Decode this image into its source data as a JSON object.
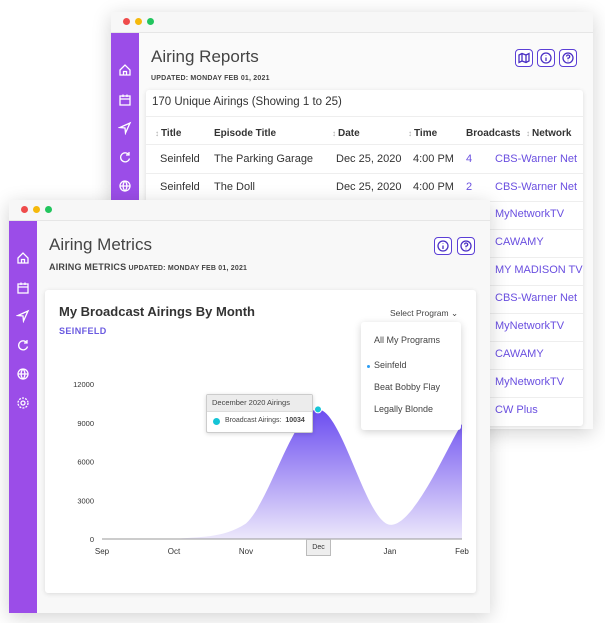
{
  "reports": {
    "title": "Airing Reports",
    "updated": "UPDATED: MONDAY FEB 01, 2021",
    "caption": "170 Unique Airings (Showing 1 to 25)",
    "columns": [
      "Title",
      "Episode Title",
      "Date",
      "Time",
      "Broadcasts",
      "Network"
    ],
    "rows": [
      {
        "title": "Seinfeld",
        "episode": "The Parking Garage",
        "date": "Dec 25, 2020",
        "time": "4:00 PM",
        "broadcasts": "4",
        "network": "CBS-Warner Net"
      },
      {
        "title": "Seinfeld",
        "episode": "The Doll",
        "date": "Dec 25, 2020",
        "time": "4:00 PM",
        "broadcasts": "2",
        "network": "CBS-Warner Net"
      }
    ],
    "more_networks": [
      "MyNetworkTV",
      "CAWAMY",
      "MY MADISON TV",
      "CBS-Warner Net",
      "MyNetworkTV",
      "CAWAMY",
      "MyNetworkTV",
      "CW Plus"
    ]
  },
  "metrics": {
    "title": "Airing Metrics",
    "updated_label": "AIRING METRICS",
    "updated": "UPDATED: MONDAY FEB 01, 2021",
    "chart_title": "My Broadcast Airings By Month",
    "program": "SEINFELD",
    "select_label": "Select Program",
    "dropdown": [
      "All My Programs",
      "Seinfeld",
      "Beat Bobby Flay",
      "Legally Blonde"
    ],
    "tooltip_title": "December 2020 Airings",
    "tooltip_label": "Broadcast Airings:",
    "tooltip_value": "10034",
    "highlight_label": "Dec"
  },
  "chart_data": {
    "type": "area",
    "title": "My Broadcast Airings By Month",
    "subtitle": "SEINFELD",
    "categories": [
      "Sep",
      "Oct",
      "Nov",
      "Dec",
      "Jan",
      "Feb"
    ],
    "series": [
      {
        "name": "Broadcast Airings",
        "values": [
          0,
          0,
          1200,
          10034,
          1100,
          8900
        ]
      }
    ],
    "yticks": [
      0,
      3000,
      6000,
      9000,
      12000
    ],
    "ylim": [
      0,
      12000
    ],
    "colors": {
      "fill_top": "#6b4cf0",
      "fill_bottom": "#ece8fb",
      "point": "#18c6d8"
    }
  },
  "colors": {
    "sidebar": "#9b4de8",
    "accent": "#5b3fd6",
    "link": "#6a4fe0"
  }
}
